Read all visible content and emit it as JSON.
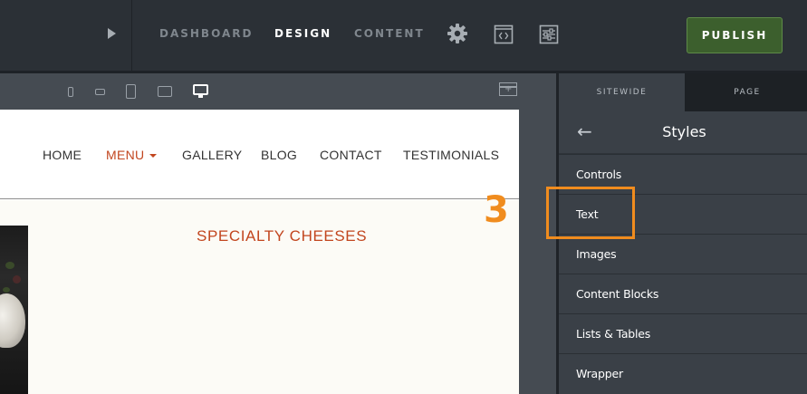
{
  "topbar": {
    "nav": [
      {
        "label": "DASHBOARD",
        "active": false
      },
      {
        "label": "DESIGN",
        "active": true
      },
      {
        "label": "CONTENT",
        "active": false
      }
    ],
    "icons": [
      "play-icon",
      "gear-icon",
      "code-icon",
      "sliders-icon"
    ],
    "publish_label": "PUBLISH"
  },
  "canvas": {
    "device_icons": [
      "phone-portrait-icon",
      "phone-landscape-icon",
      "tablet-portrait-icon",
      "tablet-landscape-icon",
      "desktop-icon"
    ],
    "active_device": "desktop-icon"
  },
  "site": {
    "nav": [
      "HOME",
      "MENU",
      "GALLERY",
      "BLOG",
      "CONTACT",
      "TESTIMONIALS"
    ],
    "active_nav": "MENU",
    "section_title": "SPECIALTY CHEESES",
    "accent_color": "#c2461f"
  },
  "annotation": {
    "step": "3",
    "color": "#f08c1e"
  },
  "panel": {
    "tabs": [
      {
        "label": "SITEWIDE",
        "active": true
      },
      {
        "label": "PAGE",
        "active": false
      }
    ],
    "title": "Styles",
    "items": [
      "Controls",
      "Text",
      "Images",
      "Content Blocks",
      "Lists & Tables",
      "Wrapper"
    ],
    "highlighted_item": "Text"
  }
}
